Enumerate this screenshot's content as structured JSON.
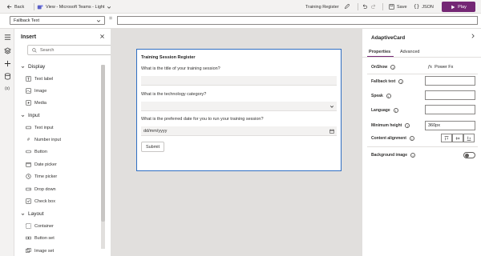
{
  "topbar": {
    "back_label": "Back",
    "view_label": "View - Microsoft Teams - Light",
    "app_name": "Training Register",
    "save_label": "Save",
    "json_label": "JSON",
    "play_label": "Play"
  },
  "formula": {
    "property": "Fallback Text",
    "equals": "="
  },
  "insert_pane": {
    "title": "Insert",
    "search_placeholder": "Search",
    "categories": [
      {
        "label": "Display",
        "items": [
          {
            "label": "Text label",
            "icon": "text-label-icon"
          },
          {
            "label": "Image",
            "icon": "image-icon"
          },
          {
            "label": "Media",
            "icon": "media-icon"
          }
        ]
      },
      {
        "label": "Input",
        "items": [
          {
            "label": "Text input",
            "icon": "text-input-icon"
          },
          {
            "label": "Number input",
            "icon": "number-input-icon"
          },
          {
            "label": "Button",
            "icon": "button-icon"
          },
          {
            "label": "Date picker",
            "icon": "date-picker-icon"
          },
          {
            "label": "Time picker",
            "icon": "time-picker-icon"
          },
          {
            "label": "Drop down",
            "icon": "drop-down-icon"
          },
          {
            "label": "Check box",
            "icon": "check-box-icon"
          }
        ]
      },
      {
        "label": "Layout",
        "items": [
          {
            "label": "Container",
            "icon": "container-icon"
          },
          {
            "label": "Button set",
            "icon": "button-set-icon"
          },
          {
            "label": "Image set",
            "icon": "image-set-icon"
          }
        ]
      }
    ]
  },
  "card": {
    "title": "Training Session Register",
    "q1": "What is the title of your training session?",
    "q2": "What is the technology category?",
    "q3": "What is the preferred date for you to run your training session?",
    "date_placeholder": "dd/mm/yyyy",
    "submit_label": "Submit"
  },
  "properties": {
    "title": "AdaptiveCard",
    "tab_properties": "Properties",
    "tab_advanced": "Advanced",
    "onshow_label": "OnShow",
    "onshow_value": "Power Fx",
    "fallback_label": "Fallback text",
    "speak_label": "Speak",
    "language_label": "Language",
    "minheight_label": "Minimum height",
    "minheight_value": "360px",
    "content_align_label": "Content alignment",
    "bgimage_label": "Background image"
  },
  "colors": {
    "accent": "#742774",
    "card_border": "#2f6ec2"
  }
}
